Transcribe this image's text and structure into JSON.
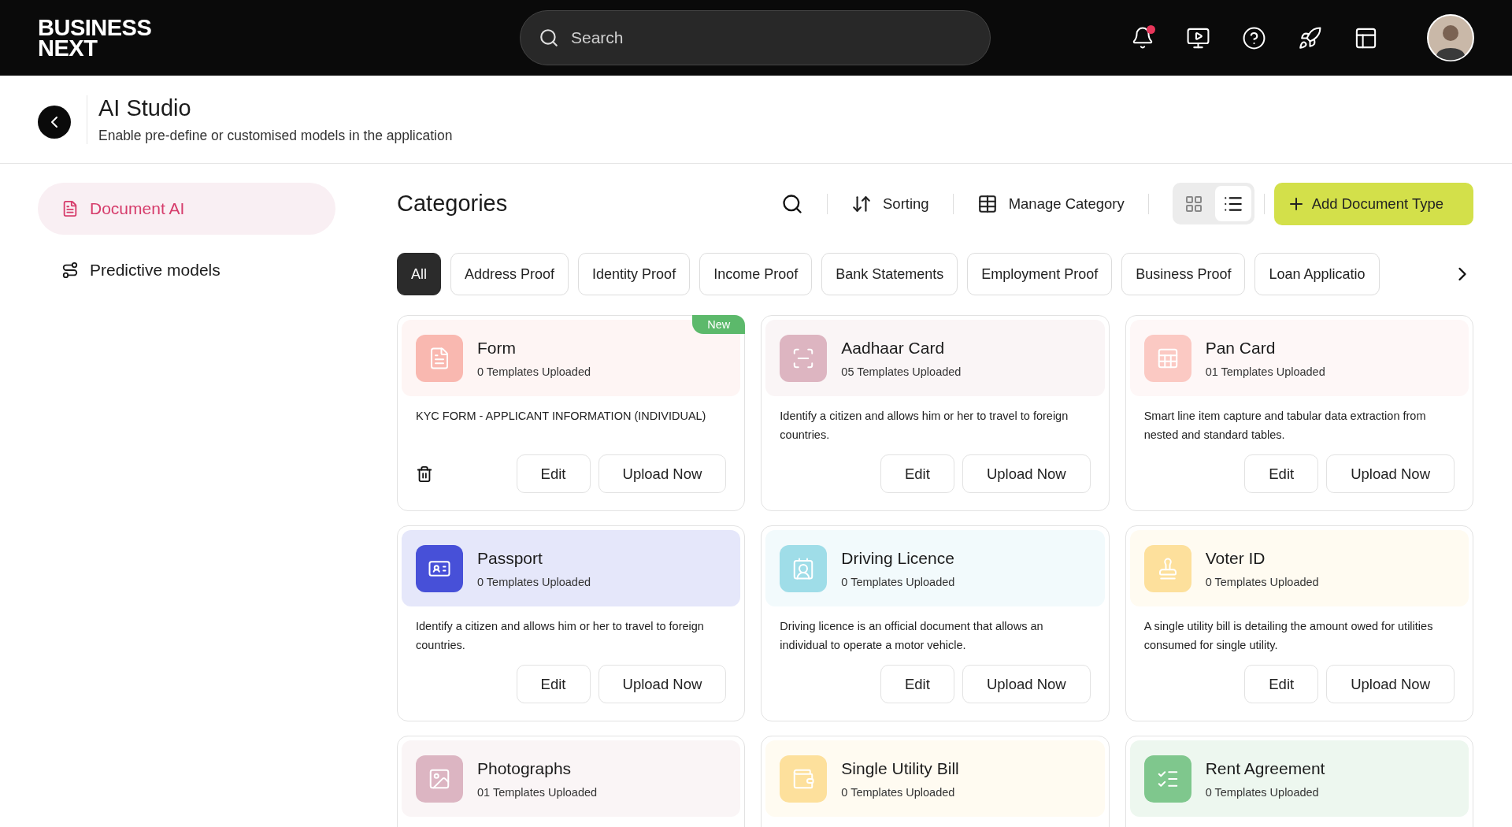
{
  "topbar": {
    "logo": [
      "BUSINESS",
      "NEXT"
    ],
    "search": {
      "placeholder": "Search"
    },
    "notifications": {
      "unread": true
    }
  },
  "header": {
    "title": "AI Studio",
    "subtitle": "Enable pre-define or customised models in the application"
  },
  "sidebar": {
    "items": [
      {
        "label": "Document AI",
        "selected": true
      },
      {
        "label": "Predictive models",
        "selected": false
      }
    ]
  },
  "toolbar": {
    "title": "Categories",
    "sorting": "Sorting",
    "manage": "Manage Category",
    "views": [
      {
        "selected": false
      },
      {
        "selected": true
      }
    ],
    "add": "Add Document Type"
  },
  "chips": [
    {
      "label": "All",
      "selected": true
    },
    {
      "label": "Address Proof",
      "selected": false
    },
    {
      "label": "Identity Proof",
      "selected": false
    },
    {
      "label": "Income Proof",
      "selected": false
    },
    {
      "label": "Bank Statements",
      "selected": false
    },
    {
      "label": "Employment Proof",
      "selected": false
    },
    {
      "label": "Business Proof",
      "selected": false
    },
    {
      "label": "Loan Applicatio",
      "selected": false
    }
  ],
  "cards": [
    {
      "title": "Form",
      "count": "0 Templates Uploaded",
      "color": "#f9b8b0",
      "badge": "New",
      "description": "KYC FORM - APPLICANT INFORMATION (INDIVIDUAL)",
      "deletable": true,
      "actions": [
        "Edit",
        "Upload Now"
      ]
    },
    {
      "title": "Aadhaar Card",
      "count": "05 Templates Uploaded",
      "color": "#ddb5c1",
      "description": "Identify a citizen and allows him or her to travel to foreign countries.",
      "deletable": false,
      "actions": [
        "Edit",
        "Upload Now"
      ]
    },
    {
      "title": "Pan Card",
      "count": "01 Templates Uploaded",
      "color": "#fbc9c3",
      "description": "Smart line item capture and tabular data extraction from nested and standard tables.",
      "deletable": false,
      "actions": [
        "Edit",
        "Upload Now"
      ]
    },
    {
      "title": "Passport",
      "count": "0 Templates Uploaded",
      "color": "#4750d8",
      "description": "Identify a citizen and allows him or her to travel to foreign countries.",
      "deletable": false,
      "actions": [
        "Edit",
        "Upload Now"
      ]
    },
    {
      "title": "Driving Licence",
      "count": "0 Templates Uploaded",
      "color": "#9fdde8",
      "description": "Driving licence is an official document that allows an individual to operate a motor vehicle.",
      "deletable": false,
      "actions": [
        "Edit",
        "Upload Now"
      ]
    },
    {
      "title": "Voter ID",
      "count": "0 Templates Uploaded",
      "color": "#fde09c",
      "description": "A single utility bill is detailing the amount owed for utilities consumed for single utility.",
      "deletable": false,
      "actions": [
        "Edit",
        "Upload Now"
      ]
    },
    {
      "title": "Photographs",
      "count": "01 Templates Uploaded",
      "color": "#dcb5c2"
    },
    {
      "title": "Single Utility Bill",
      "count": "0 Templates Uploaded",
      "color": "#fde09c"
    },
    {
      "title": "Rent Agreement",
      "count": "0 Templates Uploaded",
      "color": "#7fc78d"
    }
  ]
}
